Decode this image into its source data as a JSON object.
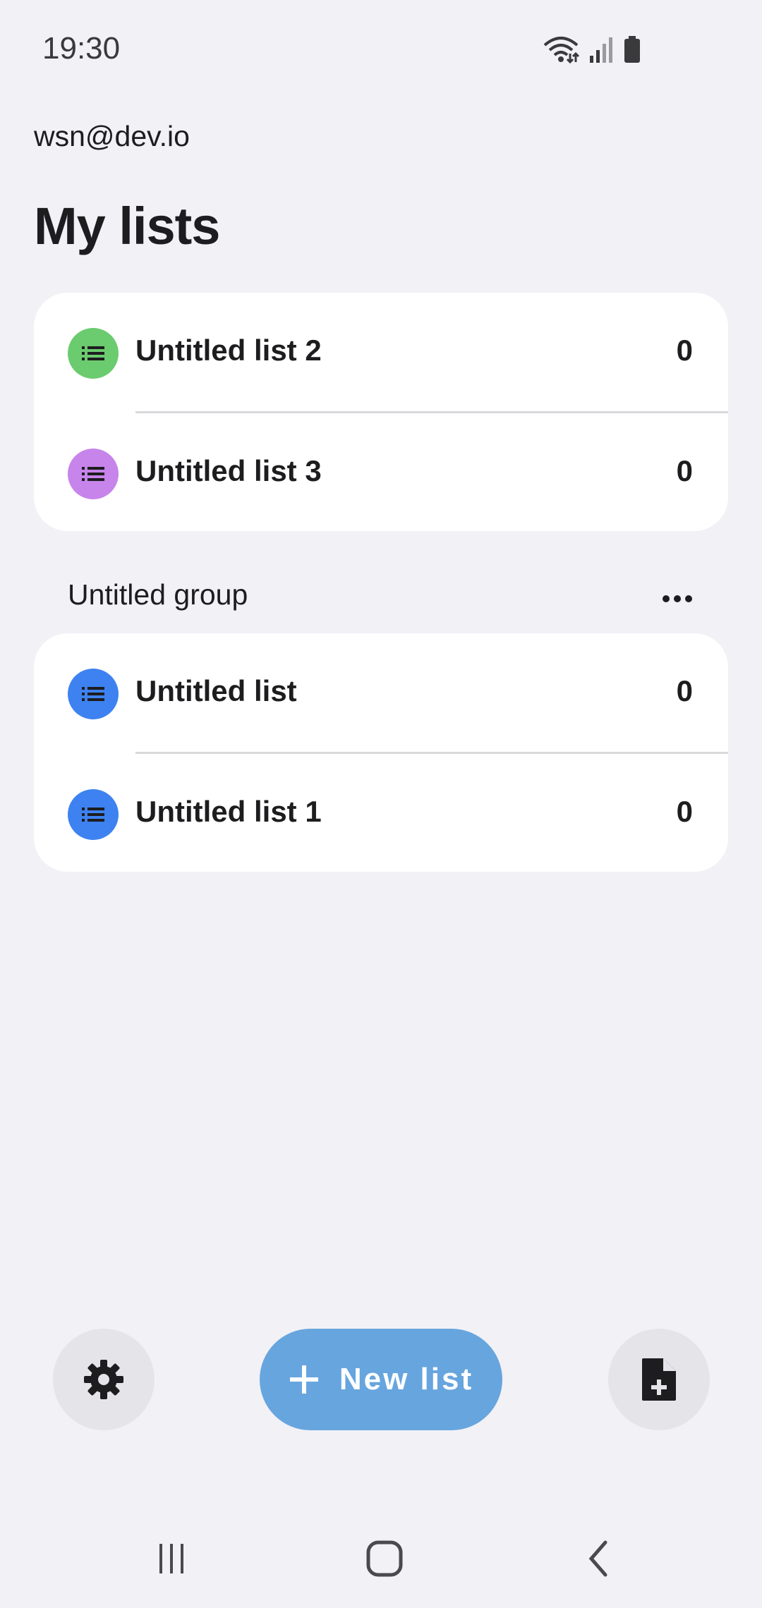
{
  "status": {
    "time": "19:30",
    "icons": [
      "wifi-icon",
      "signal-icon",
      "battery-icon"
    ]
  },
  "account": {
    "email": "wsn@dev.io"
  },
  "title": "My lists",
  "ungrouped_lists": [
    {
      "name": "Untitled list 2",
      "count": "0",
      "icon_color": "#6bcb6f"
    },
    {
      "name": "Untitled list 3",
      "count": "0",
      "icon_color": "#c784ea"
    }
  ],
  "group": {
    "name": "Untitled group",
    "lists": [
      {
        "name": "Untitled list",
        "count": "0",
        "icon_color": "#3d82f0"
      },
      {
        "name": "Untitled list 1",
        "count": "0",
        "icon_color": "#3d82f0"
      }
    ]
  },
  "bottom_bar": {
    "new_list_label": "New list",
    "settings_icon": "gear-icon",
    "new_file_icon": "file-add-icon",
    "fab_color": "#67a5de"
  },
  "nav": {
    "items": [
      "recent-apps-icon",
      "home-icon",
      "back-icon"
    ]
  }
}
